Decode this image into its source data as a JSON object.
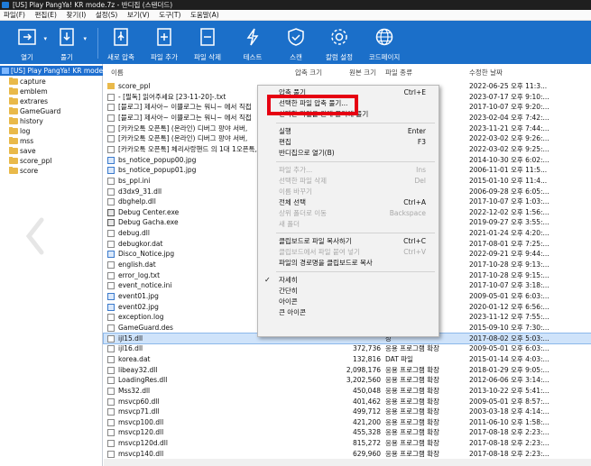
{
  "window": {
    "title": "[US] Play PangYa! KR mode.7z - 반디집 (스탠더드)"
  },
  "menubar": [
    "파일(F)",
    "편집(E)",
    "찾기(I)",
    "설정(S)",
    "보기(V)",
    "도구(T)",
    "도움말(A)"
  ],
  "toolbar": {
    "open": "열기",
    "extract": "풀기",
    "new_archive": "새로 압축",
    "add_file": "파일 추가",
    "delete_file": "파일 삭제",
    "test": "테스트",
    "scan": "스캔",
    "settings": "칼럼 설정",
    "codepage": "코드페이지"
  },
  "tree": {
    "root": "[US] Play PangYa! KR mode.7z",
    "folders": [
      "capture",
      "emblem",
      "extrares",
      "GameGuard",
      "history",
      "log",
      "mss",
      "save",
      "score_ppl",
      "score"
    ]
  },
  "columns": {
    "name": "이름",
    "packed": "압축 크기",
    "size": "원본 크기",
    "type": "파일 종류",
    "date": "수정한 날짜"
  },
  "files": [
    {
      "name": "score_ppl",
      "packed": "",
      "size": "",
      "type": "",
      "date": "2022-06-25 오후 11:3...",
      "icon": "fold"
    },
    {
      "name": "- [필독] 읽어주세요 [23-11-20]-.txt",
      "packed": "",
      "size": "",
      "type": "",
      "date": "2023-07-17 오후 9:10:...",
      "icon": "doc"
    },
    {
      "name": "[블로그] 제사아~ 이쁠로그는 워니~ 에서 직접",
      "packed": "",
      "size": "",
      "type": "",
      "date": "2017-10-07 오후 9:20:...",
      "icon": "doc"
    },
    {
      "name": "[블로그] 제사아~ 이쁠로그는 워니~ 에서 직접",
      "packed": "",
      "size": "",
      "type": "",
      "date": "2023-02-04 오후 7:42:...",
      "icon": "doc"
    },
    {
      "name": "[카카오톡 오픈톡] (온라인) 디버그 팡야 서버,",
      "packed": "",
      "size": "",
      "type": "",
      "date": "2023-11-21 오후 7:44:...",
      "icon": "doc"
    },
    {
      "name": "[카카오톡 오픈톡] (온라인) 디버그 팡야 서버,",
      "packed": "",
      "size": "",
      "type": "",
      "date": "2022-03-02 오후 9:26:...",
      "icon": "doc"
    },
    {
      "name": "[카카오톡 오픈톡] 체리사랑핸드 의 1대 1오픈톡,",
      "packed": "",
      "size": "",
      "type": "",
      "date": "2022-03-02 오후 9:25:...",
      "icon": "doc"
    },
    {
      "name": "bs_notice_popup00.jpg",
      "packed": "",
      "size": "",
      "type": "",
      "date": "2014-10-30 오후 6:02:...",
      "icon": "img"
    },
    {
      "name": "bs_notice_popup01.jpg",
      "packed": "",
      "size": "",
      "type": "",
      "date": "2006-11-01 오후 11:5...",
      "icon": "img"
    },
    {
      "name": "bs_ppl.ini",
      "packed": "",
      "size": "",
      "type": "",
      "date": "2015-01-10 오후 11:4...",
      "icon": "doc"
    },
    {
      "name": "d3dx9_31.dll",
      "packed": "",
      "size": "",
      "type": "장",
      "date": "2006-09-28 오후 6:05:...",
      "icon": "doc"
    },
    {
      "name": "dbghelp.dll",
      "packed": "",
      "size": "",
      "type": "장",
      "date": "2017-10-07 오후 1:03:...",
      "icon": "doc"
    },
    {
      "name": "Debug Center.exe",
      "packed": "",
      "size": "",
      "type": "",
      "date": "2022-12-02 오후 1:56:...",
      "icon": "exe"
    },
    {
      "name": "Debug Gacha.exe",
      "packed": "",
      "size": "",
      "type": "",
      "date": "2019-09-27 오후 3:55:...",
      "icon": "exe"
    },
    {
      "name": "debug.dll",
      "packed": "",
      "size": "",
      "type": "장",
      "date": "2021-01-24 오후 4:20:...",
      "icon": "doc"
    },
    {
      "name": "debugkor.dat",
      "packed": "",
      "size": "",
      "type": "",
      "date": "2017-08-01 오후 7:25:...",
      "icon": "doc"
    },
    {
      "name": "Disco_Notice.jpg",
      "packed": "",
      "size": "",
      "type": "",
      "date": "2022-09-21 오후 9:44:...",
      "icon": "img"
    },
    {
      "name": "english.dat",
      "packed": "",
      "size": "",
      "type": "",
      "date": "2017-10-28 오후 9:13:...",
      "icon": "doc"
    },
    {
      "name": "error_log.txt",
      "packed": "",
      "size": "",
      "type": "",
      "date": "2017-10-28 오후 9:15:...",
      "icon": "doc"
    },
    {
      "name": "event_notice.ini",
      "packed": "",
      "size": "",
      "type": "",
      "date": "2017-10-07 오후 3:18:...",
      "icon": "doc"
    },
    {
      "name": "event01.jpg",
      "packed": "",
      "size": "",
      "type": "",
      "date": "2009-05-01 오후 6:03:...",
      "icon": "img"
    },
    {
      "name": "event02.jpg",
      "packed": "",
      "size": "",
      "type": "",
      "date": "2020-01-12 오후 6:56:...",
      "icon": "img"
    },
    {
      "name": "exception.log",
      "packed": "",
      "size": "",
      "type": "",
      "date": "2023-11-12 오후 7:55:...",
      "icon": "doc"
    },
    {
      "name": "GameGuard.des",
      "packed": "",
      "size": "",
      "type": "",
      "date": "2015-09-10 오후 7:30:...",
      "icon": "doc"
    },
    {
      "name": "ijl15.dll",
      "packed": "",
      "size": "",
      "type": "장",
      "date": "2017-08-02 오후 5:03:...",
      "icon": "doc",
      "selected": true
    },
    {
      "name": "ijl16.dll",
      "packed": "",
      "size": "372,736",
      "type": "응용 프로그램 확장",
      "date": "2009-05-01 오후 6:03:...",
      "icon": "doc"
    },
    {
      "name": "korea.dat",
      "packed": "",
      "size": "132,816",
      "type": "DAT 파일",
      "date": "2015-01-14 오후 4:03:...",
      "icon": "doc"
    },
    {
      "name": "libeay32.dll",
      "packed": "",
      "size": "2,098,176",
      "type": "응용 프로그램 확장",
      "date": "2018-01-29 오후 9:05:...",
      "icon": "doc"
    },
    {
      "name": "LoadingRes.dll",
      "packed": "",
      "size": "3,202,560",
      "type": "응용 프로그램 확장",
      "date": "2012-06-06 오후 3:14:...",
      "icon": "doc"
    },
    {
      "name": "Mss32.dll",
      "packed": "",
      "size": "450,048",
      "type": "응용 프로그램 확장",
      "date": "2013-10-22 오후 5:41:...",
      "icon": "doc"
    },
    {
      "name": "msvcp60.dll",
      "packed": "",
      "size": "401,462",
      "type": "응용 프로그램 확장",
      "date": "2009-05-01 오후 8:57:...",
      "icon": "doc"
    },
    {
      "name": "msvcp71.dll",
      "packed": "",
      "size": "499,712",
      "type": "응용 프로그램 확장",
      "date": "2003-03-18 오후 4:14:...",
      "icon": "doc"
    },
    {
      "name": "msvcp100.dll",
      "packed": "",
      "size": "421,200",
      "type": "응용 프로그램 확장",
      "date": "2011-06-10 오후 1:58:...",
      "icon": "doc"
    },
    {
      "name": "msvcp120.dll",
      "packed": "",
      "size": "455,328",
      "type": "응용 프로그램 확장",
      "date": "2017-08-18 오후 2:23:...",
      "icon": "doc"
    },
    {
      "name": "msvcp120d.dll",
      "packed": "",
      "size": "815,272",
      "type": "응용 프로그램 확장",
      "date": "2017-08-18 오후 2:23:...",
      "icon": "doc"
    },
    {
      "name": "msvcp140.dll",
      "packed": "",
      "size": "629,960",
      "type": "응용 프로그램 확장",
      "date": "2017-08-18 오후 2:23:...",
      "icon": "doc"
    }
  ],
  "context_menu": [
    {
      "label": "압축 풀기",
      "shortcut": "Ctrl+E",
      "enabled": true
    },
    {
      "label": "선택한 파일 압축 풀기...",
      "shortcut": "",
      "enabled": true
    },
    {
      "label": "선택한 파일을 원래 폴더에 풀기",
      "shortcut": "",
      "enabled": true
    },
    {
      "sep": true
    },
    {
      "label": "실행",
      "shortcut": "Enter",
      "enabled": true
    },
    {
      "label": "편집",
      "shortcut": "F3",
      "enabled": true
    },
    {
      "label": "반디집으로 열기(B)",
      "shortcut": "",
      "enabled": true
    },
    {
      "sep": true
    },
    {
      "label": "파일 추가...",
      "shortcut": "Ins",
      "enabled": false
    },
    {
      "label": "선택한 파일 삭제",
      "shortcut": "Del",
      "enabled": false
    },
    {
      "label": "이름 바꾸기",
      "shortcut": "",
      "enabled": false
    },
    {
      "label": "전체 선택",
      "shortcut": "Ctrl+A",
      "enabled": true
    },
    {
      "label": "상위 폴더로 이동",
      "shortcut": "Backspace",
      "enabled": false
    },
    {
      "label": "새 폴더",
      "shortcut": "",
      "enabled": false
    },
    {
      "sep": true
    },
    {
      "label": "클립보드로 파일 복사하기",
      "shortcut": "Ctrl+C",
      "enabled": true
    },
    {
      "label": "클립보드에서 파일 붙여 넣기",
      "shortcut": "Ctrl+V",
      "enabled": false
    },
    {
      "label": "파일의 경로명을 클립보드로 복사",
      "shortcut": "",
      "enabled": true
    },
    {
      "sep": true
    },
    {
      "label": "자세히",
      "shortcut": "",
      "enabled": true,
      "checked": true
    },
    {
      "label": "간단히",
      "shortcut": "",
      "enabled": true
    },
    {
      "label": "아이콘",
      "shortcut": "",
      "enabled": true
    },
    {
      "label": "큰 아이콘",
      "shortcut": "",
      "enabled": true
    }
  ],
  "colors": {
    "toolbar_bg": "#1b6fc9",
    "highlight_border": "#e60012",
    "selection": "#cfe3fa"
  }
}
